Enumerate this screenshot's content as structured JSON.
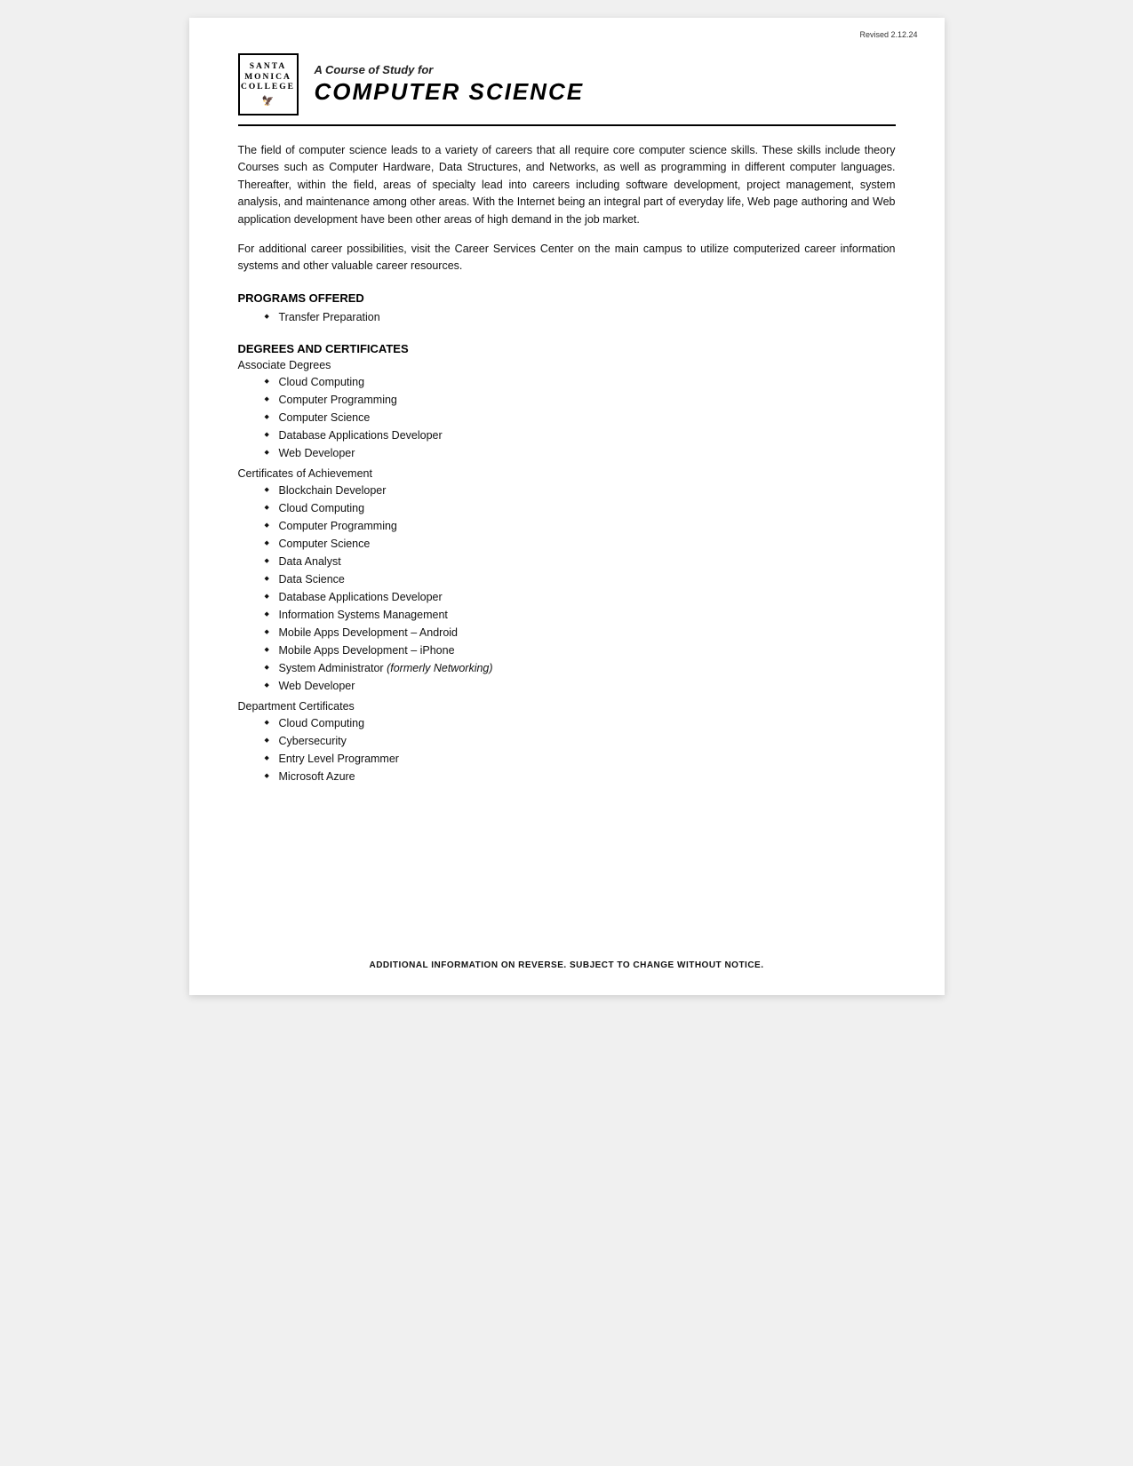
{
  "page": {
    "revised": "Revised 2.12.24",
    "footer": "ADDITIONAL INFORMATION ON REVERSE.  SUBJECT TO CHANGE WITHOUT NOTICE."
  },
  "header": {
    "logo": {
      "line1": "SANTA",
      "line2": "MONICA",
      "line3": "COLLEGE"
    },
    "course_label": "A Course of Study for",
    "title": "COMPUTER SCIENCE"
  },
  "body": {
    "paragraph1": "The field of computer science leads to a variety of careers that all require core computer science skills. These skills include theory Courses such as Computer Hardware, Data Structures, and Networks, as well as programming in different computer languages. Thereafter, within the field, areas of specialty lead into careers including software development, project management, system analysis, and maintenance among other areas. With the Internet being an integral part of everyday life, Web page authoring and Web application development have been other areas of high demand in the job market.",
    "paragraph2": "For additional career possibilities, visit the Career Services Center on the main campus to utilize computerized career information systems and other valuable career resources.",
    "programs_heading": "PROGRAMS OFFERED",
    "programs": [
      "Transfer Preparation"
    ],
    "degrees_heading": "DEGREES AND CERTIFICATES",
    "associate_label": "Associate Degrees",
    "associate_degrees": [
      "Cloud Computing",
      "Computer Programming",
      "Computer Science",
      "Database Applications Developer",
      "Web Developer"
    ],
    "certificates_achievement_label": "Certificates of Achievement",
    "certificates_achievement": [
      "Blockchain Developer",
      "Cloud Computing",
      "Computer Programming",
      "Computer Science",
      "Data Analyst",
      "Data Science",
      "Database Applications Developer",
      "Information Systems Management",
      "Mobile Apps Development – Android",
      "Mobile Apps Development – iPhone",
      "System Administrator (formerly Networking)",
      "Web Developer"
    ],
    "dept_certificates_label": "Department Certificates",
    "dept_certificates": [
      "Cloud Computing",
      "Cybersecurity",
      "Entry Level Programmer",
      "Microsoft Azure"
    ]
  }
}
